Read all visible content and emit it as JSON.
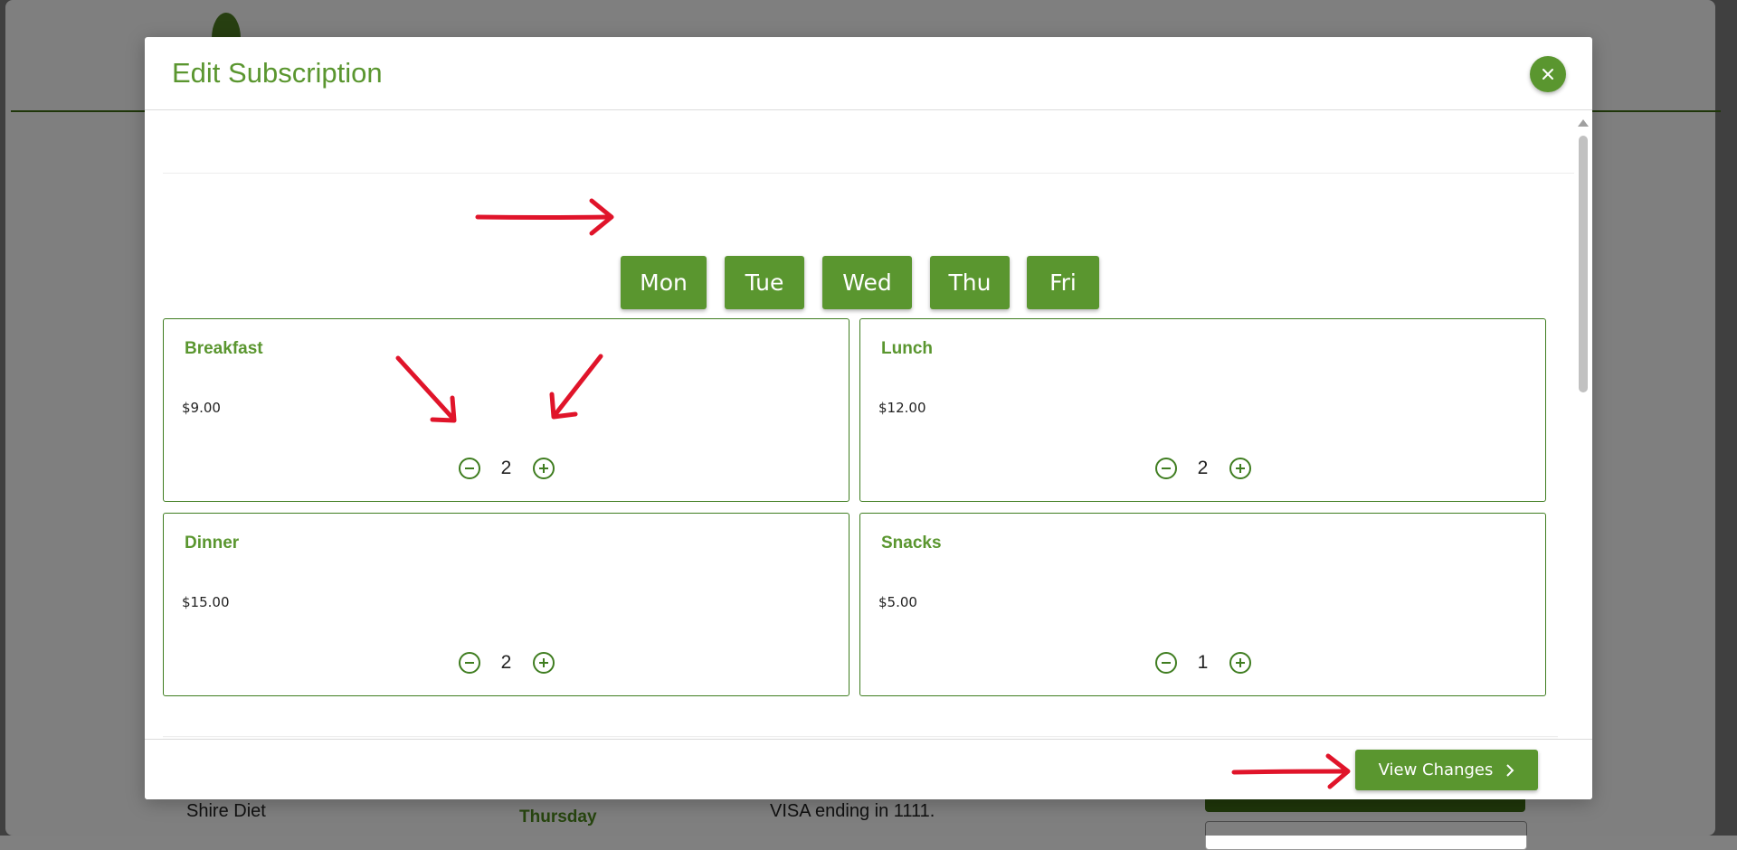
{
  "background": {
    "plan_name": "Shire Diet",
    "day": "Thursday",
    "payment": "VISA ending in 1111."
  },
  "modal": {
    "title": "Edit Subscription",
    "close_icon": "close-icon",
    "days": [
      "Mon",
      "Tue",
      "Wed",
      "Thu",
      "Fri"
    ],
    "selected_day": "Mon",
    "meals": [
      {
        "name": "Breakfast",
        "price": "$9.00",
        "quantity": "2"
      },
      {
        "name": "Lunch",
        "price": "$12.00",
        "quantity": "2"
      },
      {
        "name": "Dinner",
        "price": "$15.00",
        "quantity": "2"
      },
      {
        "name": "Snacks",
        "price": "$5.00",
        "quantity": "1"
      }
    ],
    "footer": {
      "view_changes_label": "View Changes",
      "view_changes_icon": "chevron-right-icon"
    }
  },
  "colors": {
    "accent": "#5a962f",
    "card_border": "#3f7d20",
    "annotation_arrow": "#e0142a"
  }
}
